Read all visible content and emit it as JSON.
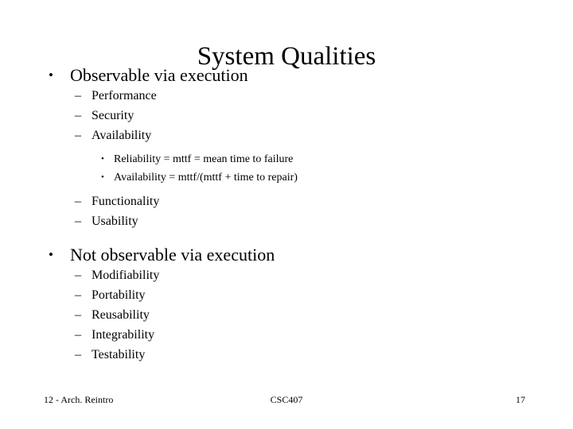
{
  "slide": {
    "title": "System Qualities",
    "bullets": [
      {
        "level": 1,
        "marker": "•",
        "text": "Observable via execution"
      },
      {
        "level": 2,
        "marker": "–",
        "text": "Performance"
      },
      {
        "level": 2,
        "marker": "–",
        "text": "Security"
      },
      {
        "level": 2,
        "marker": "–",
        "text": "Availability"
      },
      {
        "level": 3,
        "marker": "•",
        "text": "Reliability = mttf = mean time to failure"
      },
      {
        "level": 3,
        "marker": "•",
        "text": "Availability = mttf/(mttf + time to repair)"
      },
      {
        "level": 2,
        "marker": "–",
        "text": "Functionality"
      },
      {
        "level": 2,
        "marker": "–",
        "text": "Usability"
      },
      {
        "level": 1,
        "marker": "•",
        "text": "Not observable via execution"
      },
      {
        "level": 2,
        "marker": "–",
        "text": "Modifiability"
      },
      {
        "level": 2,
        "marker": "–",
        "text": "Portability"
      },
      {
        "level": 2,
        "marker": "–",
        "text": "Reusability"
      },
      {
        "level": 2,
        "marker": "–",
        "text": "Integrability"
      },
      {
        "level": 2,
        "marker": "–",
        "text": "Testability"
      }
    ],
    "footer": {
      "left": "12 - Arch. Reintro",
      "center": "CSC407",
      "right": "17"
    }
  }
}
